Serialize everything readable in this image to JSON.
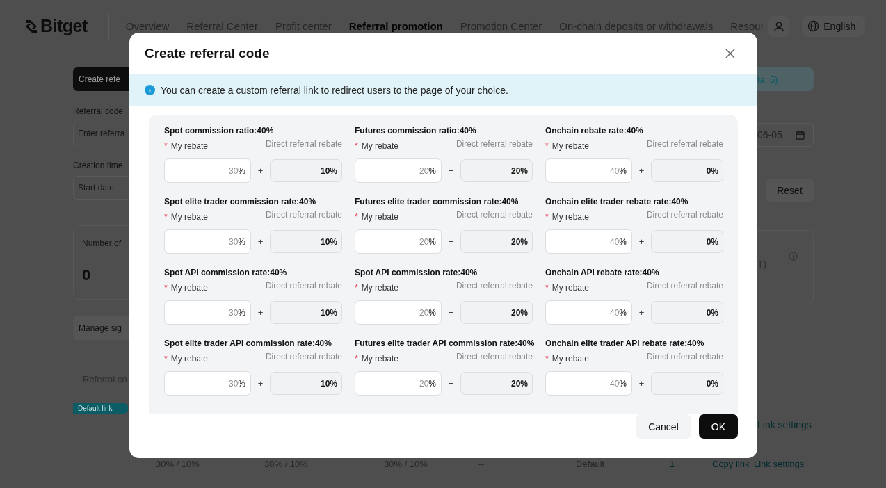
{
  "header": {
    "logo": "Bitget",
    "nav": [
      {
        "label": "Overview",
        "selected": false
      },
      {
        "label": "Referral Center",
        "selected": false
      },
      {
        "label": "Profit center",
        "selected": false
      },
      {
        "label": "Referral promotion",
        "selected": true
      },
      {
        "label": "Promotion Center",
        "selected": false
      },
      {
        "label": "On-chain deposits or withdrawals",
        "selected": false
      },
      {
        "label": "Resour",
        "selected": false
      }
    ],
    "language": "English"
  },
  "page": {
    "create_button": "Create refe",
    "referral_code_label": "Referral code",
    "referral_code_placeholder": "Enter referra",
    "creation_time_label": "Creation time",
    "start_date_placeholder": "Start date",
    "end_date": "06-05",
    "notice": "ta: 5)",
    "reset_button": "Reset",
    "stat_label": "Number of",
    "stat_value": "0",
    "stat_unit": "T)",
    "manage_button": "Manage sig",
    "table_header": "Referral co",
    "default_tag": "Default link",
    "row_link": "Link settings",
    "last_row": [
      "30% / 10%",
      "30% / 10%",
      "30% / 10%",
      "--",
      "Default",
      "1"
    ],
    "copy_link": "Copy link",
    "last_row_link": "Link settings"
  },
  "modal": {
    "title": "Create referral code",
    "info": "You can create a custom referral link to redirect users to the page of your choice.",
    "groups": [
      {
        "title": "Spot commission ratio:40%",
        "required": true,
        "my_rebate_label": "My rebate",
        "my_rebate_placeholder": "30",
        "suffix": "%",
        "direct_label": "Direct referral rebate",
        "direct_value": "10%"
      },
      {
        "title": "Futures commission ratio:40%",
        "required": true,
        "my_rebate_label": "My rebate",
        "my_rebate_placeholder": "20",
        "suffix": "%",
        "direct_label": "Direct referral rebate",
        "direct_value": "20%"
      },
      {
        "title": "Onchain rebate rate:40%",
        "required": true,
        "my_rebate_label": "My rebate",
        "my_rebate_placeholder": "40",
        "suffix": "%",
        "direct_label": "Direct referral rebate",
        "direct_value": "0%"
      },
      {
        "title": "Spot elite trader commission rate:40%",
        "required": true,
        "my_rebate_label": "My rebate",
        "my_rebate_placeholder": "30",
        "suffix": "%",
        "direct_label": "Direct referral rebate",
        "direct_value": "10%"
      },
      {
        "title": "Futures elite trader commission rate:40%",
        "required": true,
        "my_rebate_label": "My rebate",
        "my_rebate_placeholder": "20",
        "suffix": "%",
        "direct_label": "Direct referral rebate",
        "direct_value": "20%"
      },
      {
        "title": "Onchain elite trader rebate rate:40%",
        "required": true,
        "my_rebate_label": "My rebate",
        "my_rebate_placeholder": "40",
        "suffix": "%",
        "direct_label": "Direct referral rebate",
        "direct_value": "0%"
      },
      {
        "title": "Spot API commission rate:40%",
        "required": true,
        "my_rebate_label": "My rebate",
        "my_rebate_placeholder": "30",
        "suffix": "%",
        "direct_label": "Direct referral rebate",
        "direct_value": "10%"
      },
      {
        "title": "Spot API commission rate:40%",
        "required": true,
        "my_rebate_label": "My rebate",
        "my_rebate_placeholder": "20",
        "suffix": "%",
        "direct_label": "Direct referral rebate",
        "direct_value": "20%"
      },
      {
        "title": "Onchain API rebate rate:40%",
        "required": true,
        "my_rebate_label": "My rebate",
        "my_rebate_placeholder": "40",
        "suffix": "%",
        "direct_label": "Direct referral rebate",
        "direct_value": "0%"
      },
      {
        "title": "Spot elite trader API commission rate:40%",
        "required": true,
        "my_rebate_label": "My rebate",
        "my_rebate_placeholder": "30",
        "suffix": "%",
        "direct_label": "Direct referral rebate",
        "direct_value": "10%"
      },
      {
        "title": "Futures elite trader API commission rate:40%",
        "required": true,
        "my_rebate_label": "My rebate",
        "my_rebate_placeholder": "20",
        "suffix": "%",
        "direct_label": "Direct referral rebate",
        "direct_value": "20%"
      },
      {
        "title": "Onchain elite trader API rebate rate:40%",
        "required": true,
        "my_rebate_label": "My rebate",
        "my_rebate_placeholder": "40",
        "suffix": "%",
        "direct_label": "Direct referral rebate",
        "direct_value": "0%"
      }
    ],
    "required_mark": "*",
    "plus_sign": "+",
    "buttons": [
      {
        "label": "Cancel",
        "kind": "secondary"
      },
      {
        "label": "OK",
        "kind": "primary"
      }
    ]
  }
}
